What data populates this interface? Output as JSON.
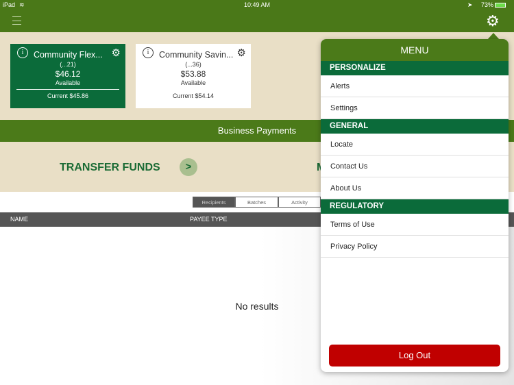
{
  "status": {
    "device": "iPad",
    "time": "10:49 AM",
    "battery": "73%"
  },
  "accounts": [
    {
      "name": "Community  Flex...",
      "number": "(...21)",
      "available_amount": "$46.12",
      "available_label": "Available",
      "current": "Current $45.86"
    },
    {
      "name": "Community Savin...",
      "number": "(...36)",
      "available_amount": "$53.88",
      "available_label": "Available",
      "current": "Current $54.14"
    }
  ],
  "section_title": "Business Payments",
  "transfer_label": "TRANSFER FUNDS",
  "transfer_label_2": "M",
  "segments": [
    "Recipients",
    "Batches",
    "Activity"
  ],
  "table": {
    "columns": [
      "NAME",
      "PAYEE TYPE"
    ],
    "empty": "No results"
  },
  "menu": {
    "title": "MENU",
    "sections": [
      {
        "label": "PERSONALIZE",
        "items": [
          "Alerts",
          "Settings"
        ]
      },
      {
        "label": "GENERAL",
        "items": [
          "Locate",
          "Contact Us",
          "About Us"
        ]
      },
      {
        "label": "REGULATORY",
        "items": [
          "Terms of Use",
          "Privacy Policy"
        ]
      }
    ],
    "logout": "Log Out"
  },
  "colors": {
    "brand_green": "#4b7a19",
    "dark_green": "#0b6b3a",
    "logout_red": "#c00000"
  }
}
